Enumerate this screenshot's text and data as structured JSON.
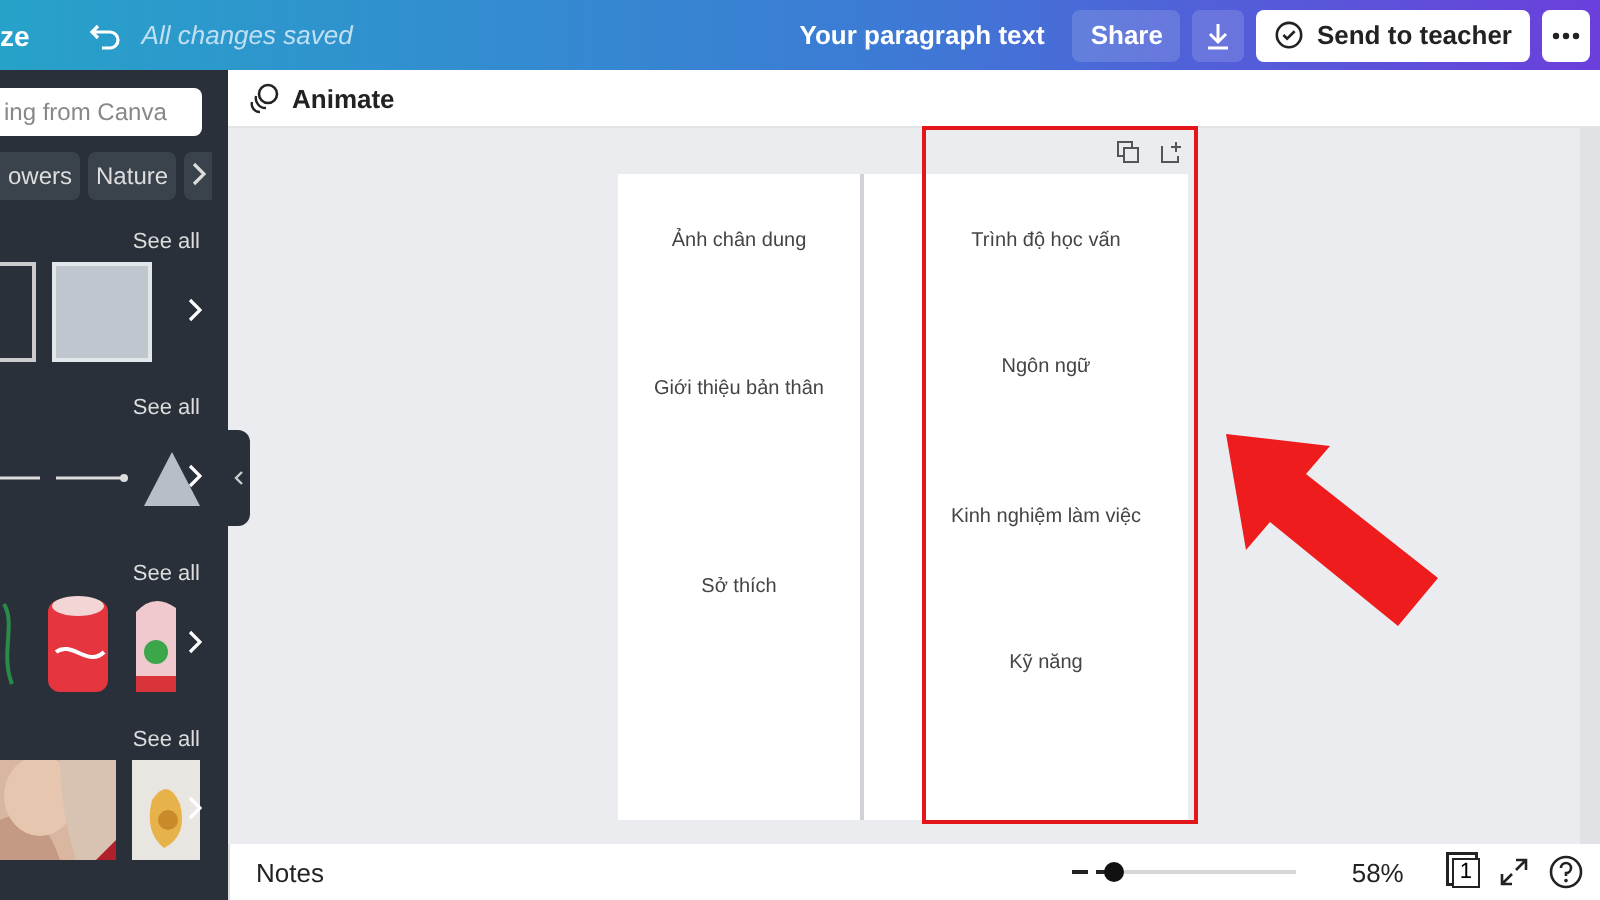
{
  "top_bar": {
    "resize_label": "ze",
    "save_status": "All changes saved",
    "document_title": "Your paragraph text",
    "buttons": [
      {
        "kind": "share",
        "label": "Share"
      },
      {
        "kind": "download"
      },
      {
        "kind": "send",
        "label": "Send to teacher"
      },
      {
        "kind": "more"
      }
    ]
  },
  "sidebar": {
    "search": {
      "placeholder": "ing from Canva"
    },
    "chips": [
      "owers",
      "Nature"
    ],
    "sections": [
      {
        "kind": "shapes",
        "link": "See all"
      },
      {
        "kind": "lines",
        "link": "See all"
      },
      {
        "kind": "stickers",
        "link": "See all"
      },
      {
        "kind": "photos",
        "link": "See all"
      }
    ]
  },
  "toolbar": {
    "animate": "Animate"
  },
  "canvas": {
    "left_column": [
      "Ảnh chân dung",
      "Giới thiệu bản thân",
      "Sở thích"
    ],
    "right_column": [
      "Trình độ học vấn",
      "Ngôn ngữ",
      "Kinh nghiệm làm việc",
      "Kỹ năng"
    ]
  },
  "footer": {
    "notes": "Notes",
    "zoom": {
      "level": 0.09,
      "reading": "58%"
    },
    "page_count": "1"
  }
}
